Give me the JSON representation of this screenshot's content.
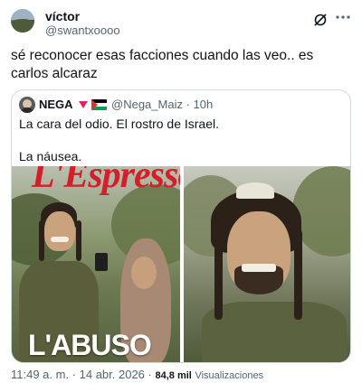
{
  "author": {
    "display_name": "víctor",
    "handle": "@swantxoooo"
  },
  "icons": {
    "grok": "grok-icon",
    "more": "more-icon"
  },
  "tweet": {
    "text": "sé reconocer esas facciones cuando las veo.. es carlos alcaraz"
  },
  "quote": {
    "display_name": "NEGA",
    "handle_time": "@Nega_Maiz · 10h",
    "line1": "La cara del odio. El rostro de Israel.",
    "line2": "La náusea.",
    "media": {
      "left_title": "L'Espresso",
      "left_caption": "L'ABUSO"
    }
  },
  "footer": {
    "timestamp": "11:49 a. m. · 14 abr. 2026 ·",
    "views_count": "84,8 mil",
    "views_label": "Visualizaciones"
  },
  "colors": {
    "text_primary": "#0f1419",
    "text_secondary": "#536471",
    "border": "#cfd9de",
    "magazine_red": "#d41f2a"
  }
}
